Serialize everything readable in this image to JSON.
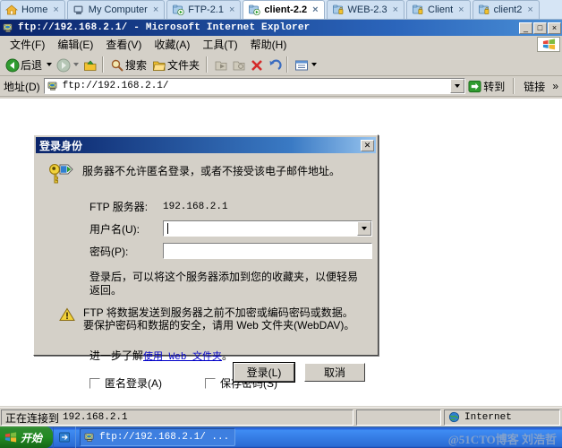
{
  "tabstrip": {
    "tabs": [
      {
        "label": "Home",
        "icon": "home-icon",
        "active": false,
        "close": "×"
      },
      {
        "label": "My Computer",
        "icon": "computer-icon",
        "active": false,
        "close": "×"
      },
      {
        "label": "FTP-2.1",
        "icon": "folder-run-icon",
        "active": false,
        "close": "×"
      },
      {
        "label": "client-2.2",
        "icon": "folder-run-icon",
        "active": true,
        "close": "×"
      },
      {
        "label": "WEB-2.3",
        "icon": "folder-lock-icon",
        "active": false,
        "close": "×"
      },
      {
        "label": "Client",
        "icon": "folder-lock-icon",
        "active": false,
        "close": "×"
      },
      {
        "label": "client2",
        "icon": "folder-lock-icon",
        "active": false,
        "close": "×"
      }
    ]
  },
  "window": {
    "title": "ftp://192.168.2.1/ - Microsoft Internet Explorer",
    "minimize_label": "_",
    "maximize_label": "□",
    "close_label": "×"
  },
  "menubar": {
    "items": [
      {
        "label": "文件(F)"
      },
      {
        "label": "编辑(E)"
      },
      {
        "label": "查看(V)"
      },
      {
        "label": "收藏(A)"
      },
      {
        "label": "工具(T)"
      },
      {
        "label": "帮助(H)"
      }
    ]
  },
  "toolbar": {
    "back_label": "后退",
    "forward_label": "",
    "up_label": "",
    "search_label": "搜索",
    "folders_label": "文件夹",
    "views_label": ""
  },
  "addressbar": {
    "label": "地址(D)",
    "value": "ftp://192.168.2.1/",
    "go_label": "转到",
    "links_label": "链接"
  },
  "dialog": {
    "title": "登录身份",
    "close_label": "✕",
    "message": "服务器不允许匿名登录，或者不接受该电子邮件地址。",
    "server_label": "FTP 服务器:",
    "server_value": "192.168.2.1",
    "username_label": "用户名(U):",
    "username_value": "",
    "password_label": "密码(P):",
    "password_value": "",
    "note": "登录后，可以将这个服务器添加到您的收藏夹，以便轻易返回。",
    "warning": "FTP 将数据发送到服务器之前不加密或编码密码或数据。要保护密码和数据的安全，请用 Web 文件夹(WebDAV)。",
    "learn_prefix": "进一步了解",
    "learn_link": "使用 Web 文件夹",
    "learn_suffix": "。",
    "anonymous_label": "匿名登录(A)",
    "anonymous_checked": false,
    "savepass_label": "保存密码(S)",
    "savepass_checked": false,
    "login_button": "登录(L)",
    "cancel_button": "取消"
  },
  "statusbar": {
    "status_text": "正在连接到",
    "status_host": "192.168.2.1",
    "zone_label": "Internet"
  },
  "taskbar": {
    "start_label": "开始",
    "tasks": [
      {
        "label": "ftp://192.168.2.1/ ...",
        "icon": "ie-icon"
      }
    ],
    "watermark": "@51CTO博客 刘浩哲"
  }
}
